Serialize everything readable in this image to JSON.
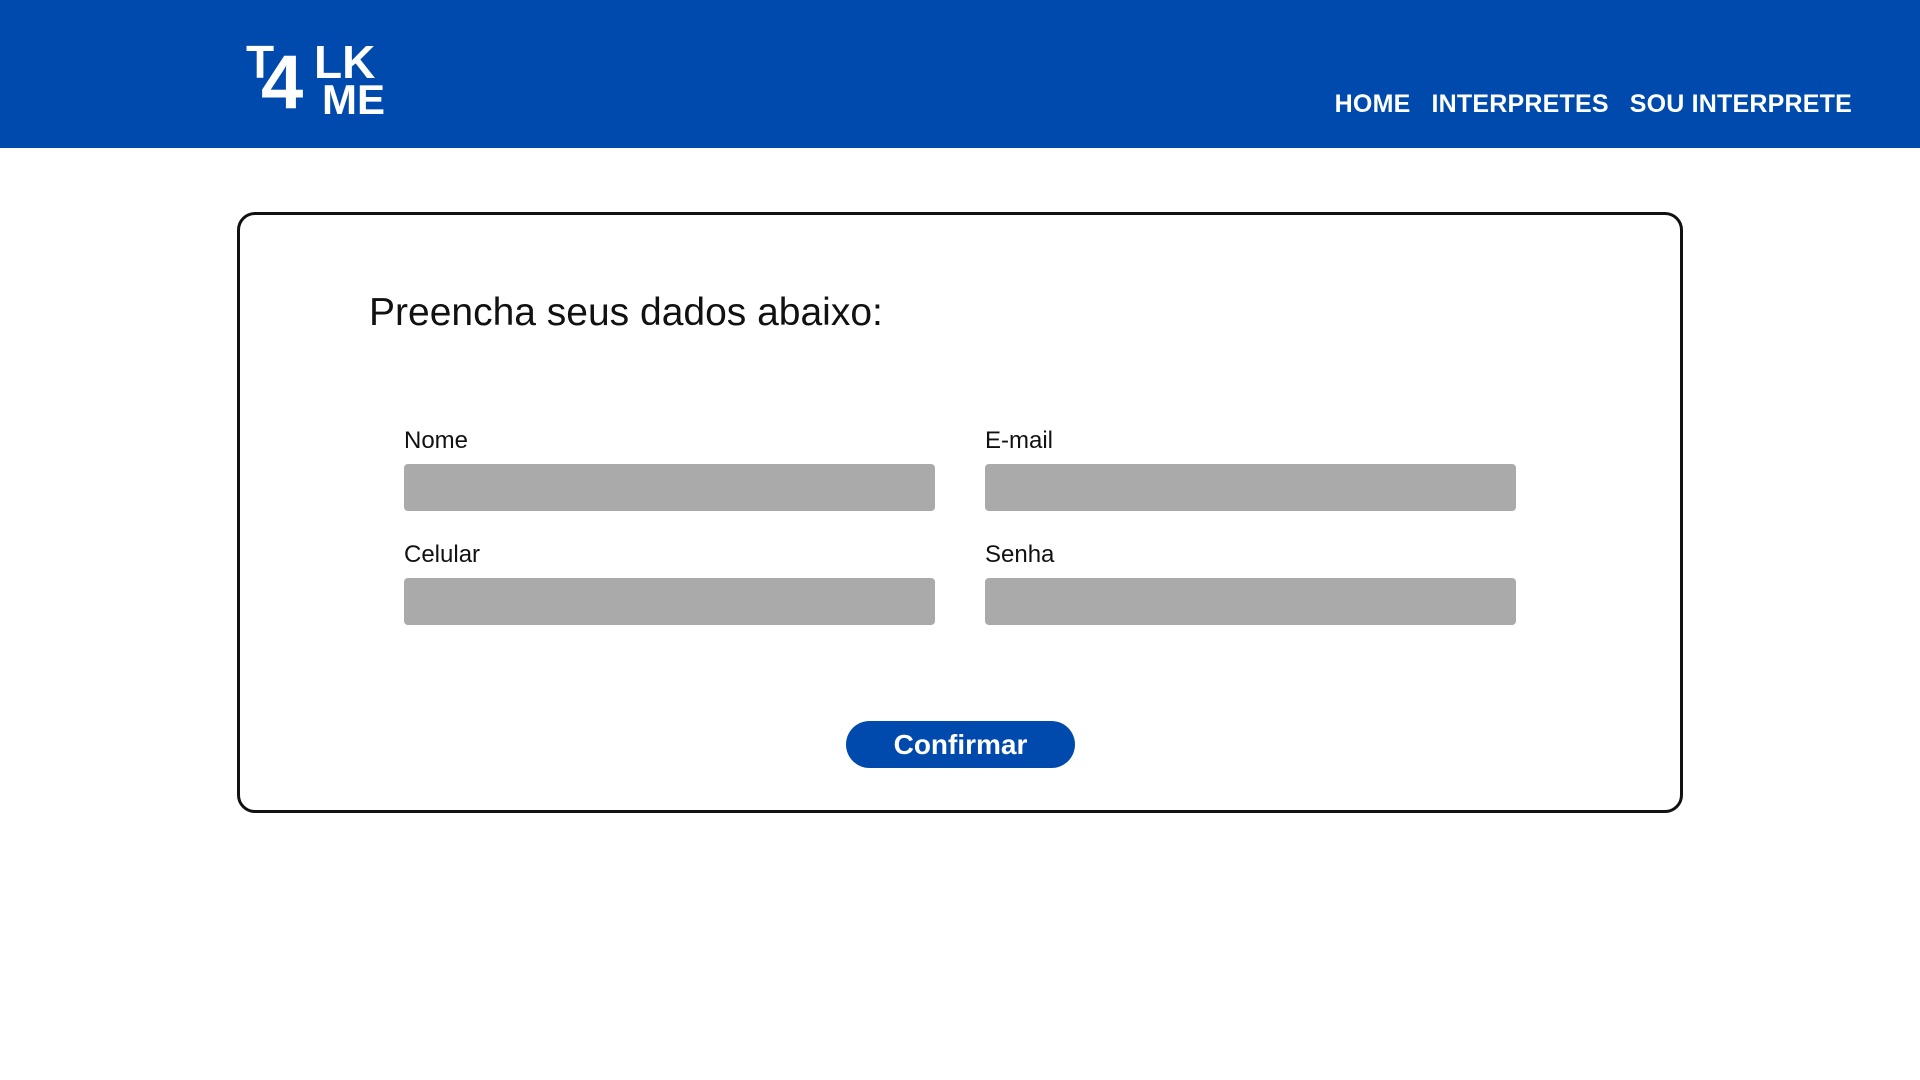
{
  "header": {
    "logo_text": "T4LK ME",
    "nav": [
      {
        "label": "HOME"
      },
      {
        "label": "INTERPRETES"
      },
      {
        "label": "SOU INTERPRETE"
      }
    ]
  },
  "form": {
    "title": "Preencha seus dados abaixo:",
    "fields": {
      "nome": {
        "label": "Nome",
        "value": ""
      },
      "email": {
        "label": "E-mail",
        "value": ""
      },
      "celular": {
        "label": "Celular",
        "value": ""
      },
      "senha": {
        "label": "Senha",
        "value": ""
      }
    },
    "confirm_label": "Confirmar"
  },
  "colors": {
    "brand_blue": "#004aad",
    "input_gray": "#aaaaaa",
    "border": "#111111"
  }
}
